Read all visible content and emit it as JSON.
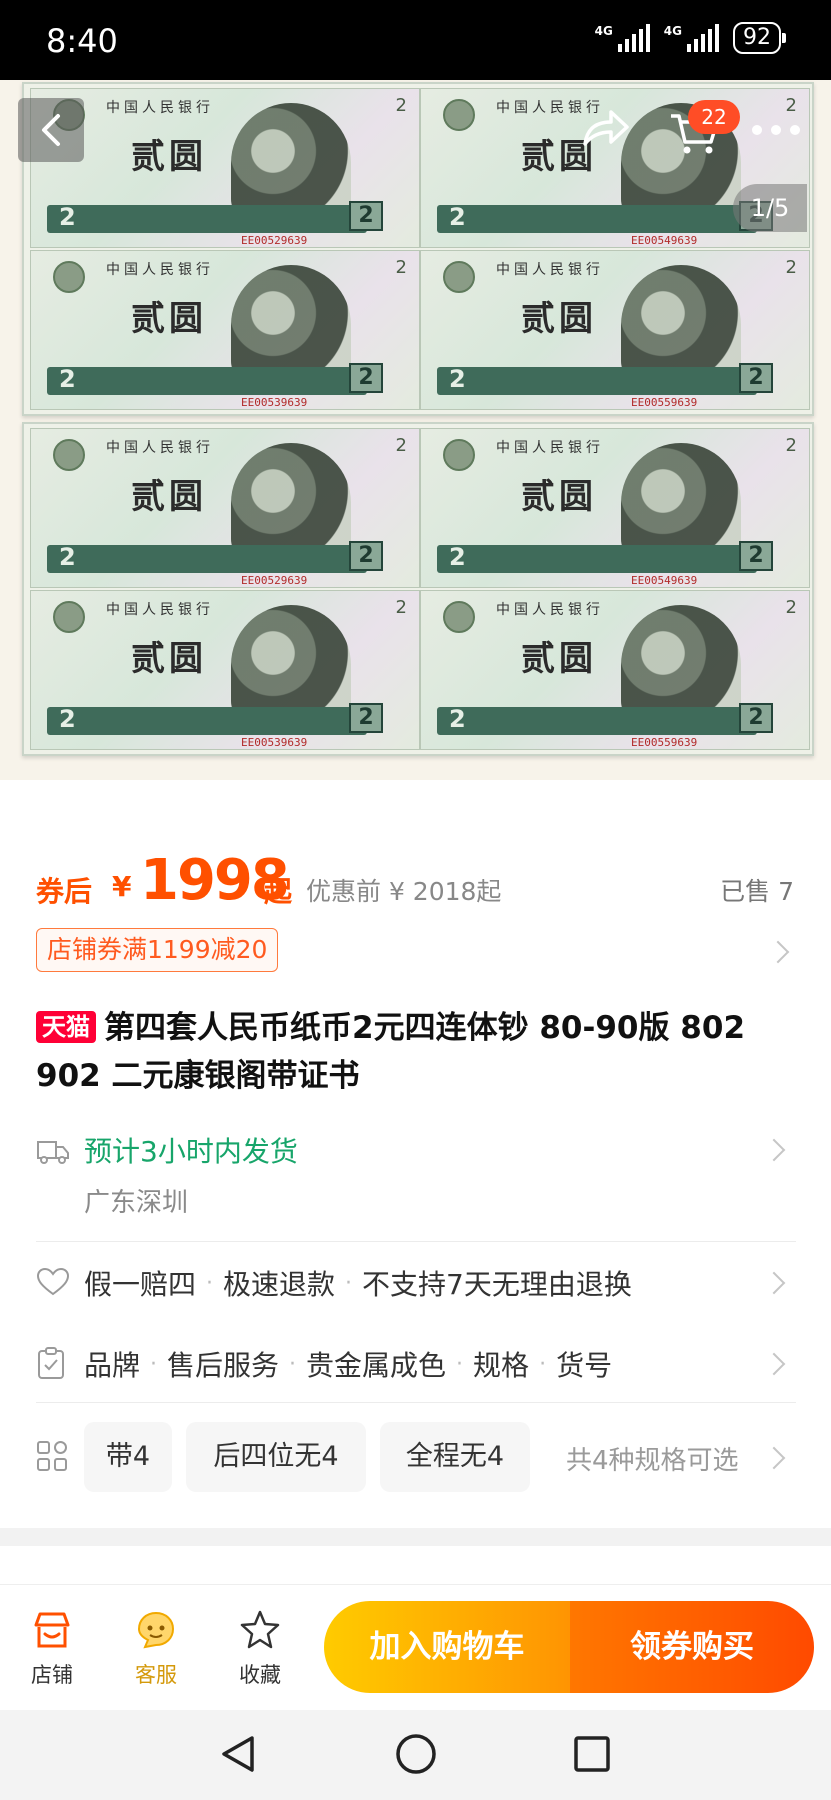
{
  "status_bar": {
    "time": "8:40",
    "network1": "4G",
    "network2": "4G",
    "battery": "92"
  },
  "header": {
    "cart_count": "22",
    "image_counter": "1/5"
  },
  "banknote": {
    "header_text": "中国人民银行",
    "denomination": "贰圆",
    "numeral": "2",
    "serials": [
      "EE00529639",
      "EE00549639",
      "EE00539639",
      "EE00559639"
    ]
  },
  "price": {
    "prefix": "券后",
    "currency": "¥",
    "amount": "1998",
    "suffix": "起",
    "original": "优惠前 ¥ 2018起",
    "sold": "已售 7"
  },
  "coupon": {
    "label": "店铺券满1199减20"
  },
  "product": {
    "badge": "天猫",
    "title": "第四套人民币纸币2元四连体钞 80-90版 802 902 二元康银阁带证书"
  },
  "shipping": {
    "estimate": "预计3小时内发货",
    "location": "广东深圳"
  },
  "guarantees": {
    "items": [
      "假一赔四",
      "极速退款",
      "不支持7天无理由退换"
    ]
  },
  "params": {
    "items": [
      "品牌",
      "售后服务",
      "贵金属成色",
      "规格",
      "货号"
    ]
  },
  "specs": {
    "options": [
      "带4",
      "后四位无4",
      "全程无4"
    ],
    "more": "共4种规格可选"
  },
  "action_bar": {
    "store": "店铺",
    "service": "客服",
    "favorite": "收藏",
    "add_cart": "加入购物车",
    "buy": "领券购买"
  },
  "colors": {
    "accent": "#ff5000",
    "tmall": "#ff0036",
    "shipping": "#17a56a"
  },
  "icons": [
    "back-icon",
    "share-icon",
    "cart-icon",
    "more-icon",
    "truck-icon",
    "heart-icon",
    "clipboard-icon",
    "grid-icon",
    "store-icon",
    "service-icon",
    "star-icon",
    "nav-back-icon",
    "nav-home-icon",
    "nav-recent-icon"
  ]
}
